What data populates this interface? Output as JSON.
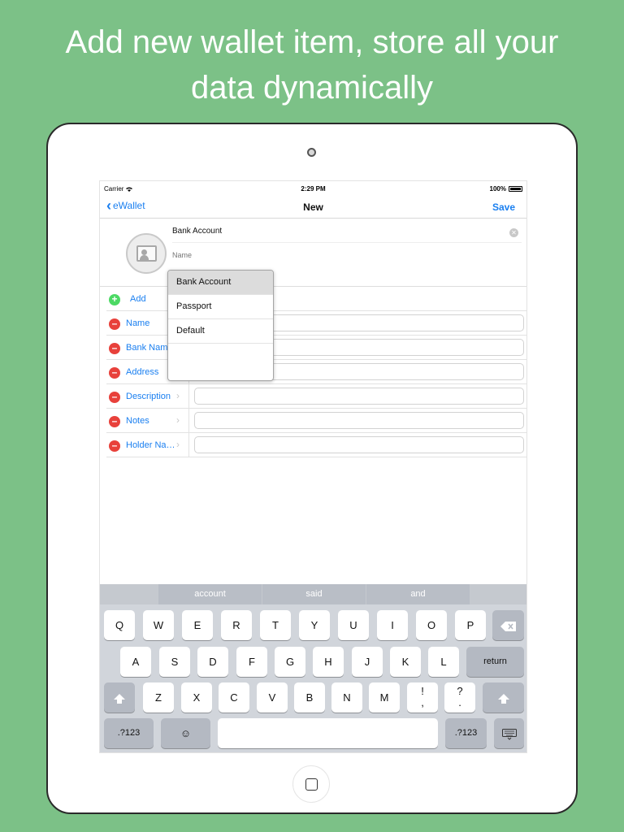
{
  "headline": {
    "line1": "Add new wallet item, store all your",
    "line2": "data dynamically"
  },
  "status": {
    "carrier": "Carrier",
    "time": "2:29 PM",
    "battery": "100%"
  },
  "nav": {
    "back": "eWallet",
    "title": "New",
    "save": "Save"
  },
  "form": {
    "type_value": "Bank Account",
    "name_placeholder": "Name",
    "add_label": "Add"
  },
  "fields": [
    {
      "label": "Name"
    },
    {
      "label": "Bank Nam"
    },
    {
      "label": "Address"
    },
    {
      "label": "Description"
    },
    {
      "label": "Notes"
    },
    {
      "label": "Holder Na…"
    }
  ],
  "dropdown": {
    "options": [
      "Bank Account",
      "Passport",
      "Default"
    ],
    "selected": "Bank Account"
  },
  "keyboard": {
    "suggestions": [
      "account",
      "said",
      "and"
    ],
    "row1": [
      "Q",
      "W",
      "E",
      "R",
      "T",
      "Y",
      "U",
      "I",
      "O",
      "P"
    ],
    "row2": [
      "A",
      "S",
      "D",
      "F",
      "G",
      "H",
      "J",
      "K",
      "L"
    ],
    "row3": [
      "Z",
      "X",
      "C",
      "V",
      "B",
      "N",
      "M"
    ],
    "row3_punct": [
      "!\n,",
      "?\n."
    ],
    "return": "return",
    "numbers": ".?123",
    "icons": {
      "backspace": "backspace-icon",
      "shift": "shift-icon",
      "emoji": "emoji-icon",
      "hide": "keyboard-hide-icon",
      "wifi": "wifi-icon",
      "battery": "battery-icon"
    }
  }
}
